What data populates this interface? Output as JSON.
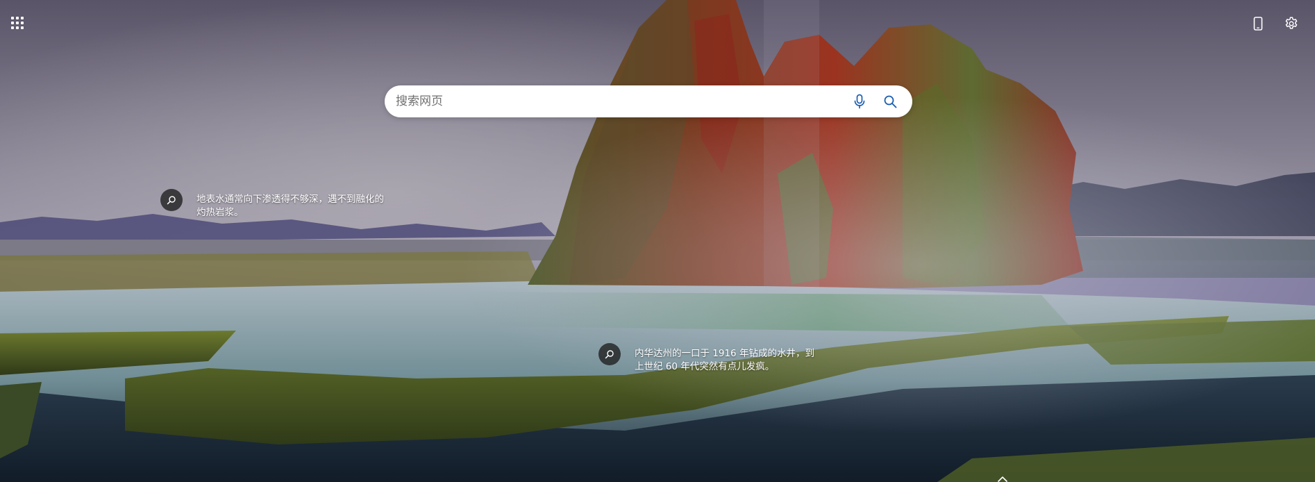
{
  "search": {
    "placeholder": "搜索网页"
  },
  "toolbar": {
    "apps_icon": "grid-icon",
    "mobile_icon": "phone-icon",
    "settings_icon": "gear-icon"
  },
  "hotspots": [
    {
      "text": "地表水通常向下渗透得不够深，遇不到融化的灼热岩浆。"
    },
    {
      "text": "内华达州的一口于 1916 年钻成的水井，到上世纪 60 年代突然有点儿发疯。"
    }
  ],
  "colors": {
    "search_icon_blue": "#1a5fb4",
    "hotspot_bg": "#2a2a2a"
  }
}
